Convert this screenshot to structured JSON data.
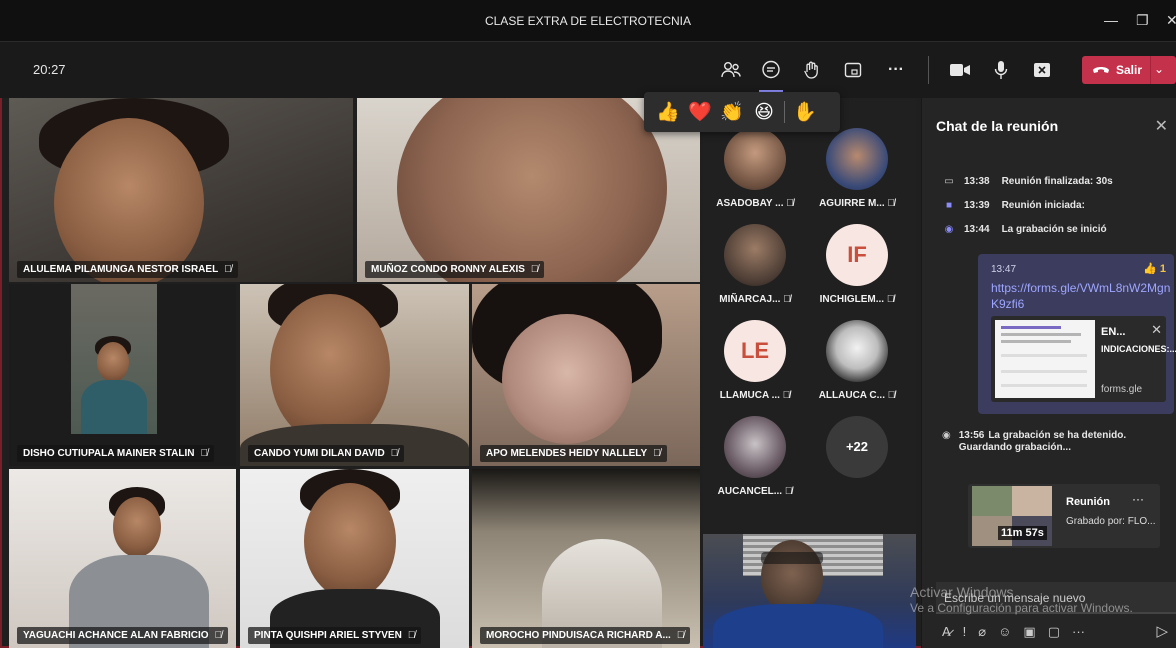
{
  "window": {
    "title": "CLASE EXTRA DE ELECTROTECNIA"
  },
  "toolbar": {
    "clock": "20:27",
    "leave_label": "Salir"
  },
  "reactions": [
    "👍",
    "❤️",
    "👏",
    "😆",
    "✋"
  ],
  "video_tiles": [
    {
      "name": "ALULEMA PILAMUNGA NESTOR ISRAEL"
    },
    {
      "name": "MUÑOZ CONDO RONNY ALEXIS"
    },
    {
      "name": "DISHO CUTIUPALA MAINER STALIN"
    },
    {
      "name": "CANDO YUMI DILAN DAVID"
    },
    {
      "name": "APO MELENDES HEIDY NALLELY"
    },
    {
      "name": "YAGUACHI ACHANCE ALAN FABRICIO"
    },
    {
      "name": "PINTA QUISHPI ARIEL STYVEN"
    },
    {
      "name": "MOROCHO PINDUISACA RICHARD A..."
    }
  ],
  "roster": [
    {
      "name": "ASADOBAY ...",
      "initials": ""
    },
    {
      "name": "AGUIRRE M...",
      "initials": ""
    },
    {
      "name": "MIÑARCAJ...",
      "initials": ""
    },
    {
      "name": "INCHIGLEM...",
      "initials": "IF"
    },
    {
      "name": "LLAMUCA ...",
      "initials": "LE"
    },
    {
      "name": "ALLAUCA C...",
      "initials": ""
    },
    {
      "name": "AUCANCEL...",
      "initials": ""
    },
    {
      "name": "",
      "initials": "+22"
    }
  ],
  "chat": {
    "title": "Chat de la reunión",
    "events": [
      {
        "time": "13:38",
        "text": "Reunión finalizada: 30s"
      },
      {
        "time": "13:39",
        "text": "Reunión iniciada:"
      },
      {
        "time": "13:44",
        "text": "La grabación se inició"
      },
      {
        "time": "13:56",
        "text": "La grabación se ha detenido. Guardando grabación..."
      }
    ],
    "message": {
      "time": "13:47",
      "likes": "1",
      "link": "https://forms.gle/VWmL8nW2MgnK9zfi6",
      "card_title": "EN...",
      "card_desc": "INDICACIONES:...",
      "card_domain": "forms.gle"
    },
    "recording": {
      "title": "Reunión",
      "duration": "11m 57s",
      "subtitle": "Grabado por: FLO..."
    },
    "compose_placeholder": "Escribe un mensaje nuevo"
  },
  "watermark": {
    "line1": "Activar Windows",
    "line2": "Ve a Configuración para activar Windows."
  }
}
